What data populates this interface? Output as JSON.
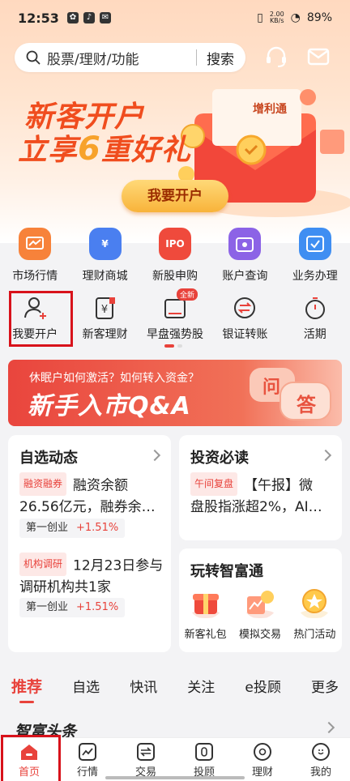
{
  "status_bar": {
    "time": "12:53",
    "net_speed_top": "2.00",
    "net_speed_bottom": "KB/s",
    "battery": "89%"
  },
  "search": {
    "placeholder": "股票/理财/功能",
    "button": "搜索"
  },
  "header_icons": [
    "headset-icon",
    "mail-icon"
  ],
  "banner": {
    "line1": "新客开户",
    "line2_a": "立享",
    "line2_num": "6",
    "line2_b": "重好礼",
    "envelope_text": "增利通",
    "button": "我要开户"
  },
  "grid_row1": [
    {
      "label": "市场行情",
      "icon": "chart-icon",
      "color": "#f7823a"
    },
    {
      "label": "理财商城",
      "icon": "moneybag-icon",
      "color": "#4a7ff0"
    },
    {
      "label": "新股申购",
      "icon": "ipo-icon",
      "color": "#ef4a3c",
      "icon_text": "IPO"
    },
    {
      "label": "账户查询",
      "icon": "account-query-icon",
      "color": "#8c63e6"
    },
    {
      "label": "业务办理",
      "icon": "business-icon",
      "color": "#3f8ef2"
    }
  ],
  "grid_row2": [
    {
      "label": "我要开户",
      "icon": "user-add-icon"
    },
    {
      "label": "新客理财",
      "icon": "new-finance-icon"
    },
    {
      "label": "早盘强势股",
      "icon": "morning-stock-icon",
      "badge": "全新"
    },
    {
      "label": "银证转账",
      "icon": "transfer-icon"
    },
    {
      "label": "活期",
      "icon": "stopwatch-icon"
    }
  ],
  "qa_banner": {
    "subtitle": "休眠户如何激活？如何转入资金？",
    "title": "新手入市Q&A",
    "bubble1": "问",
    "bubble2": "答"
  },
  "watchlist": {
    "title": "自选动态",
    "items": [
      {
        "tag": "融资融券",
        "text_line1": "融资余额",
        "text_line2": "26.56亿元，融券余…",
        "stock": "第一创业",
        "change": "+1.51%"
      },
      {
        "tag": "机构调研",
        "text_line1": "12月23日参与",
        "text_line2": "调研机构共1家",
        "stock": "第一创业",
        "change": "+1.51%"
      }
    ]
  },
  "must_read": {
    "title": "投资必读",
    "tag": "午间复盘",
    "text_line1": "【午报】微",
    "text_line2": "盘股指涨超2%，AI…"
  },
  "play": {
    "title": "玩转智富通",
    "items": [
      {
        "label": "新客礼包",
        "icon": "gift-icon"
      },
      {
        "label": "模拟交易",
        "icon": "simulate-icon"
      },
      {
        "label": "热门活动",
        "icon": "hot-activity-icon"
      }
    ]
  },
  "tabs": [
    "推荐",
    "自选",
    "快讯",
    "关注",
    "e投顾",
    "更多"
  ],
  "feed_title": "智富头条",
  "bottom_nav": [
    {
      "label": "首页",
      "icon": "home-icon"
    },
    {
      "label": "行情",
      "icon": "market-icon"
    },
    {
      "label": "交易",
      "icon": "trade-icon"
    },
    {
      "label": "投顾",
      "icon": "advisor-icon"
    },
    {
      "label": "理财",
      "icon": "finance-icon"
    },
    {
      "label": "我的",
      "icon": "profile-icon"
    }
  ]
}
